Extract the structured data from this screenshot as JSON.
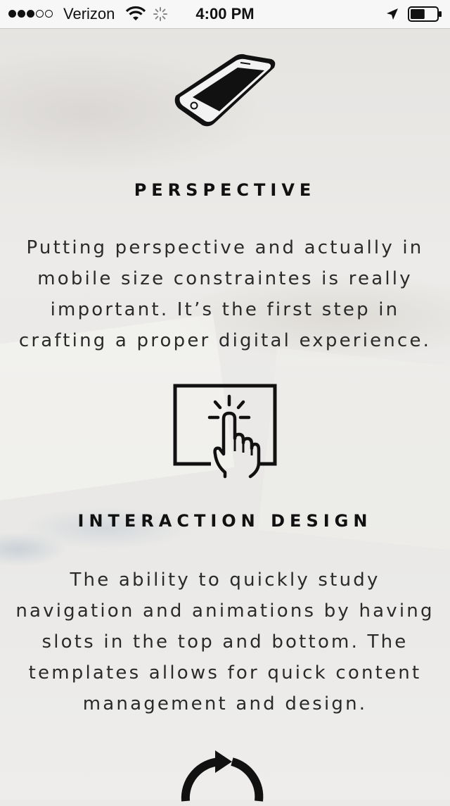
{
  "status_bar": {
    "carrier": "Verizon",
    "time": "4:00 PM",
    "signal_strength": 3,
    "signal_max": 5,
    "battery_level": 0.55,
    "icons": [
      "wifi-icon",
      "activity-spinner-icon",
      "location-arrow-icon",
      "battery-icon"
    ]
  },
  "sections": [
    {
      "icon": "smartphone-icon",
      "title": "PERSPECTIVE",
      "body": "Putting perspective and actually in\nmobile size constraintes is really\nimportant. It’s the first step in\ncrafting a proper digital experience."
    },
    {
      "icon": "touch-screen-icon",
      "title": "INTERACTION DESIGN",
      "body": "The ability to quickly study\nnavigation and animations by having\nslots in the top and bottom. The\ntemplates allows for quick content\nmanagement and design."
    },
    {
      "icon": "refresh-cycle-icon"
    }
  ]
}
